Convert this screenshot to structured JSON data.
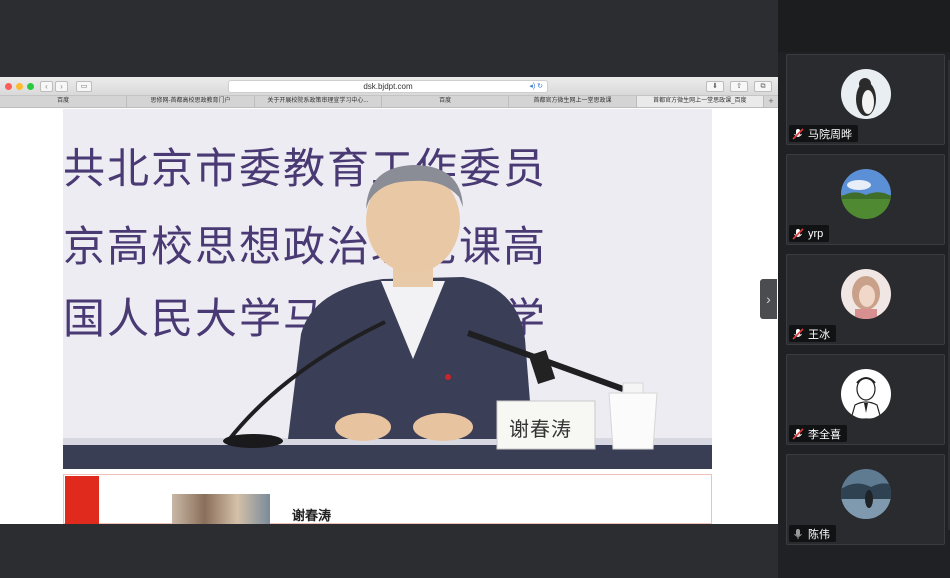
{
  "browser": {
    "address": "dsk.bjdpt.com",
    "tabs": [
      "百度",
      "思修网-首都高校思政教育门户",
      "关于开展校院系政策审理宣学习中心...",
      "百度",
      "首都官方微生网上一堂思政课",
      "首都官方微生网上一堂思政课_百度"
    ],
    "new_tab_label": "+",
    "back_label": "‹",
    "forward_label": "›"
  },
  "video": {
    "banner_lines": [
      "共北京市委教育工作委员",
      "京高校思想政治理论课高",
      "国人民大学马克思主义学"
    ],
    "nameplate": "谢春涛"
  },
  "page_below": {
    "speaker_name": "谢春涛"
  },
  "side_handle_label": "›",
  "participants": [
    {
      "name": "马院周晔",
      "avatar": "penguin-avatar-icon",
      "colors": [
        "#e9eef2",
        "#2b2b2b"
      ]
    },
    {
      "name": "yrp",
      "avatar": "landscape-avatar-icon",
      "colors": [
        "#5b8fd6",
        "#4f8a32"
      ]
    },
    {
      "name": "王冰",
      "avatar": "portrait-avatar-icon",
      "colors": [
        "#f0e6e3",
        "#c9a08a"
      ]
    },
    {
      "name": "李全喜",
      "avatar": "cartoon-man-avatar-icon",
      "colors": [
        "#ffffff",
        "#222222"
      ]
    },
    {
      "name": "陈伟",
      "avatar": "lake-avatar-icon",
      "colors": [
        "#5f7b92",
        "#2f4252"
      ]
    }
  ],
  "colors": {
    "background": "#2b2d30",
    "panel": "#202124",
    "banner_text": "#4a3a74",
    "mic_muted": "#e23b3b"
  }
}
